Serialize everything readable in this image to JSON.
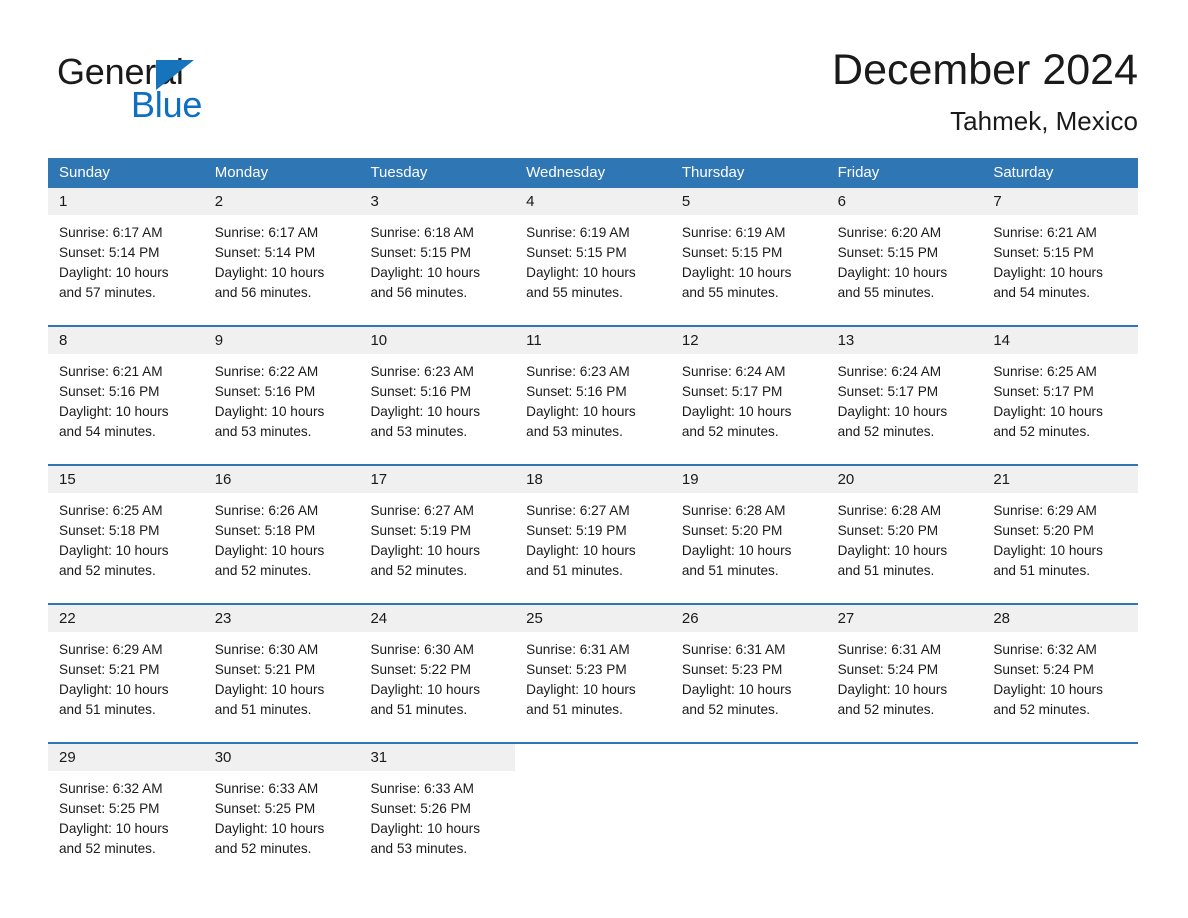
{
  "brand": {
    "name_part1": "General",
    "name_part2": "Blue",
    "logo_icon": "triangle-flag-icon",
    "accent_color": "#1574bb",
    "blue_text_color": "#0c6fc4"
  },
  "header": {
    "month_title": "December 2024",
    "location": "Tahmek, Mexico"
  },
  "theme": {
    "header_blue": "#2f76b5",
    "daynum_band_gray": "#f0f0f0",
    "text_color": "#1a1a1a"
  },
  "weekdays": [
    "Sunday",
    "Monday",
    "Tuesday",
    "Wednesday",
    "Thursday",
    "Friday",
    "Saturday"
  ],
  "weeks": [
    {
      "days": [
        {
          "date": "1",
          "sunrise": "Sunrise: 6:17 AM",
          "sunset": "Sunset: 5:14 PM",
          "daylight_line1": "Daylight: 10 hours",
          "daylight_line2": "and 57 minutes."
        },
        {
          "date": "2",
          "sunrise": "Sunrise: 6:17 AM",
          "sunset": "Sunset: 5:14 PM",
          "daylight_line1": "Daylight: 10 hours",
          "daylight_line2": "and 56 minutes."
        },
        {
          "date": "3",
          "sunrise": "Sunrise: 6:18 AM",
          "sunset": "Sunset: 5:15 PM",
          "daylight_line1": "Daylight: 10 hours",
          "daylight_line2": "and 56 minutes."
        },
        {
          "date": "4",
          "sunrise": "Sunrise: 6:19 AM",
          "sunset": "Sunset: 5:15 PM",
          "daylight_line1": "Daylight: 10 hours",
          "daylight_line2": "and 55 minutes."
        },
        {
          "date": "5",
          "sunrise": "Sunrise: 6:19 AM",
          "sunset": "Sunset: 5:15 PM",
          "daylight_line1": "Daylight: 10 hours",
          "daylight_line2": "and 55 minutes."
        },
        {
          "date": "6",
          "sunrise": "Sunrise: 6:20 AM",
          "sunset": "Sunset: 5:15 PM",
          "daylight_line1": "Daylight: 10 hours",
          "daylight_line2": "and 55 minutes."
        },
        {
          "date": "7",
          "sunrise": "Sunrise: 6:21 AM",
          "sunset": "Sunset: 5:15 PM",
          "daylight_line1": "Daylight: 10 hours",
          "daylight_line2": "and 54 minutes."
        }
      ]
    },
    {
      "days": [
        {
          "date": "8",
          "sunrise": "Sunrise: 6:21 AM",
          "sunset": "Sunset: 5:16 PM",
          "daylight_line1": "Daylight: 10 hours",
          "daylight_line2": "and 54 minutes."
        },
        {
          "date": "9",
          "sunrise": "Sunrise: 6:22 AM",
          "sunset": "Sunset: 5:16 PM",
          "daylight_line1": "Daylight: 10 hours",
          "daylight_line2": "and 53 minutes."
        },
        {
          "date": "10",
          "sunrise": "Sunrise: 6:23 AM",
          "sunset": "Sunset: 5:16 PM",
          "daylight_line1": "Daylight: 10 hours",
          "daylight_line2": "and 53 minutes."
        },
        {
          "date": "11",
          "sunrise": "Sunrise: 6:23 AM",
          "sunset": "Sunset: 5:16 PM",
          "daylight_line1": "Daylight: 10 hours",
          "daylight_line2": "and 53 minutes."
        },
        {
          "date": "12",
          "sunrise": "Sunrise: 6:24 AM",
          "sunset": "Sunset: 5:17 PM",
          "daylight_line1": "Daylight: 10 hours",
          "daylight_line2": "and 52 minutes."
        },
        {
          "date": "13",
          "sunrise": "Sunrise: 6:24 AM",
          "sunset": "Sunset: 5:17 PM",
          "daylight_line1": "Daylight: 10 hours",
          "daylight_line2": "and 52 minutes."
        },
        {
          "date": "14",
          "sunrise": "Sunrise: 6:25 AM",
          "sunset": "Sunset: 5:17 PM",
          "daylight_line1": "Daylight: 10 hours",
          "daylight_line2": "and 52 minutes."
        }
      ]
    },
    {
      "days": [
        {
          "date": "15",
          "sunrise": "Sunrise: 6:25 AM",
          "sunset": "Sunset: 5:18 PM",
          "daylight_line1": "Daylight: 10 hours",
          "daylight_line2": "and 52 minutes."
        },
        {
          "date": "16",
          "sunrise": "Sunrise: 6:26 AM",
          "sunset": "Sunset: 5:18 PM",
          "daylight_line1": "Daylight: 10 hours",
          "daylight_line2": "and 52 minutes."
        },
        {
          "date": "17",
          "sunrise": "Sunrise: 6:27 AM",
          "sunset": "Sunset: 5:19 PM",
          "daylight_line1": "Daylight: 10 hours",
          "daylight_line2": "and 52 minutes."
        },
        {
          "date": "18",
          "sunrise": "Sunrise: 6:27 AM",
          "sunset": "Sunset: 5:19 PM",
          "daylight_line1": "Daylight: 10 hours",
          "daylight_line2": "and 51 minutes."
        },
        {
          "date": "19",
          "sunrise": "Sunrise: 6:28 AM",
          "sunset": "Sunset: 5:20 PM",
          "daylight_line1": "Daylight: 10 hours",
          "daylight_line2": "and 51 minutes."
        },
        {
          "date": "20",
          "sunrise": "Sunrise: 6:28 AM",
          "sunset": "Sunset: 5:20 PM",
          "daylight_line1": "Daylight: 10 hours",
          "daylight_line2": "and 51 minutes."
        },
        {
          "date": "21",
          "sunrise": "Sunrise: 6:29 AM",
          "sunset": "Sunset: 5:20 PM",
          "daylight_line1": "Daylight: 10 hours",
          "daylight_line2": "and 51 minutes."
        }
      ]
    },
    {
      "days": [
        {
          "date": "22",
          "sunrise": "Sunrise: 6:29 AM",
          "sunset": "Sunset: 5:21 PM",
          "daylight_line1": "Daylight: 10 hours",
          "daylight_line2": "and 51 minutes."
        },
        {
          "date": "23",
          "sunrise": "Sunrise: 6:30 AM",
          "sunset": "Sunset: 5:21 PM",
          "daylight_line1": "Daylight: 10 hours",
          "daylight_line2": "and 51 minutes."
        },
        {
          "date": "24",
          "sunrise": "Sunrise: 6:30 AM",
          "sunset": "Sunset: 5:22 PM",
          "daylight_line1": "Daylight: 10 hours",
          "daylight_line2": "and 51 minutes."
        },
        {
          "date": "25",
          "sunrise": "Sunrise: 6:31 AM",
          "sunset": "Sunset: 5:23 PM",
          "daylight_line1": "Daylight: 10 hours",
          "daylight_line2": "and 51 minutes."
        },
        {
          "date": "26",
          "sunrise": "Sunrise: 6:31 AM",
          "sunset": "Sunset: 5:23 PM",
          "daylight_line1": "Daylight: 10 hours",
          "daylight_line2": "and 52 minutes."
        },
        {
          "date": "27",
          "sunrise": "Sunrise: 6:31 AM",
          "sunset": "Sunset: 5:24 PM",
          "daylight_line1": "Daylight: 10 hours",
          "daylight_line2": "and 52 minutes."
        },
        {
          "date": "28",
          "sunrise": "Sunrise: 6:32 AM",
          "sunset": "Sunset: 5:24 PM",
          "daylight_line1": "Daylight: 10 hours",
          "daylight_line2": "and 52 minutes."
        }
      ]
    },
    {
      "days": [
        {
          "date": "29",
          "sunrise": "Sunrise: 6:32 AM",
          "sunset": "Sunset: 5:25 PM",
          "daylight_line1": "Daylight: 10 hours",
          "daylight_line2": "and 52 minutes."
        },
        {
          "date": "30",
          "sunrise": "Sunrise: 6:33 AM",
          "sunset": "Sunset: 5:25 PM",
          "daylight_line1": "Daylight: 10 hours",
          "daylight_line2": "and 52 minutes."
        },
        {
          "date": "31",
          "sunrise": "Sunrise: 6:33 AM",
          "sunset": "Sunset: 5:26 PM",
          "daylight_line1": "Daylight: 10 hours",
          "daylight_line2": "and 53 minutes."
        },
        {
          "date": "",
          "sunrise": "",
          "sunset": "",
          "daylight_line1": "",
          "daylight_line2": ""
        },
        {
          "date": "",
          "sunrise": "",
          "sunset": "",
          "daylight_line1": "",
          "daylight_line2": ""
        },
        {
          "date": "",
          "sunrise": "",
          "sunset": "",
          "daylight_line1": "",
          "daylight_line2": ""
        },
        {
          "date": "",
          "sunrise": "",
          "sunset": "",
          "daylight_line1": "",
          "daylight_line2": ""
        }
      ]
    }
  ]
}
